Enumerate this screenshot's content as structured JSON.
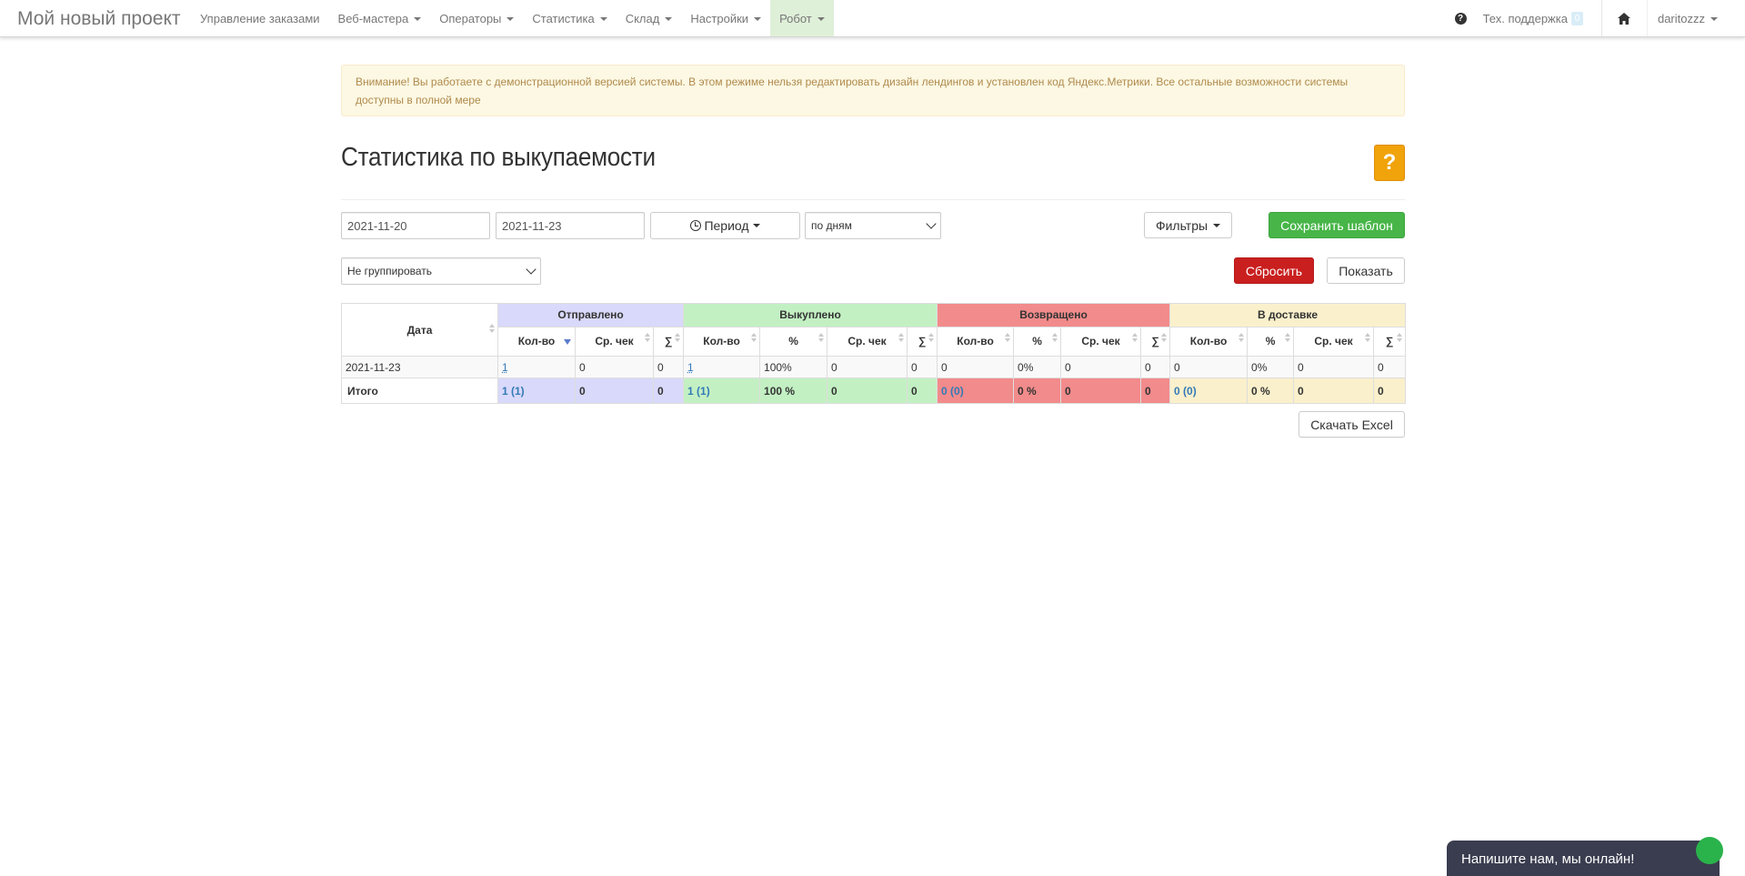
{
  "brand": "Мой новый проект",
  "nav": {
    "items": [
      {
        "label": "Управление заказами",
        "caret": false
      },
      {
        "label": "Веб-мастера",
        "caret": true
      },
      {
        "label": "Операторы",
        "caret": true
      },
      {
        "label": "Статистика",
        "caret": true
      },
      {
        "label": "Склад",
        "caret": true
      },
      {
        "label": "Настройки",
        "caret": true
      },
      {
        "label": "Робот",
        "caret": true
      }
    ],
    "support_label": "Тех. поддержка",
    "support_count": "0",
    "user": "daritozzz"
  },
  "alert": "Внимание! Вы работаете с демонстрационной версией системы. В этом режиме нельзя редактировать дизайн лендингов и установлен код Яндекс.Метрики. Все остальные возможности системы доступны в полной мере",
  "page": {
    "title": "Статистика по выкупаемости",
    "help_label": "?"
  },
  "filters": {
    "date_from": "2021-11-20",
    "date_to": "2021-11-23",
    "period_label": "Период",
    "interval": "по дням",
    "filters_label": "Фильтры",
    "save_template_label": "Сохранить шаблон",
    "grouping": "Не группировать",
    "reset_label": "Сбросить",
    "show_label": "Показать"
  },
  "table": {
    "date_header": "Дата",
    "groups": [
      "Отправлено",
      "Выкуплено",
      "Возвращено",
      "В доставке"
    ],
    "cols": {
      "qty": "Кол-во",
      "pct": "%",
      "avg": "Ср. чек",
      "sum": "∑"
    },
    "row": {
      "date": "2021-11-23",
      "sent": [
        "1",
        "0",
        "0"
      ],
      "bought": [
        "1",
        "100%",
        "0",
        "0"
      ],
      "returned": [
        "0",
        "0%",
        "0",
        "0"
      ],
      "delivery": [
        "0",
        "0%",
        "0",
        "0"
      ]
    },
    "total": {
      "label": "Итого",
      "sent": [
        "1 (1)",
        "0",
        "0"
      ],
      "bought": [
        "1 (1)",
        "100 %",
        "0",
        "0"
      ],
      "returned": [
        "0 (0)",
        "0 %",
        "0",
        "0"
      ],
      "delivery": [
        "0 (0)",
        "0 %",
        "0",
        "0"
      ]
    }
  },
  "excel_label": "Скачать Excel",
  "chat_label": "Напишите нам, мы онлайн!",
  "colors": {
    "sent": "#d9d9fb",
    "bought": "#c3f0c3",
    "returned": "#f28b8b",
    "delivery": "#faf0cc",
    "success": "#47b548",
    "danger": "#c91f1f",
    "warning": "#f0a30a"
  }
}
